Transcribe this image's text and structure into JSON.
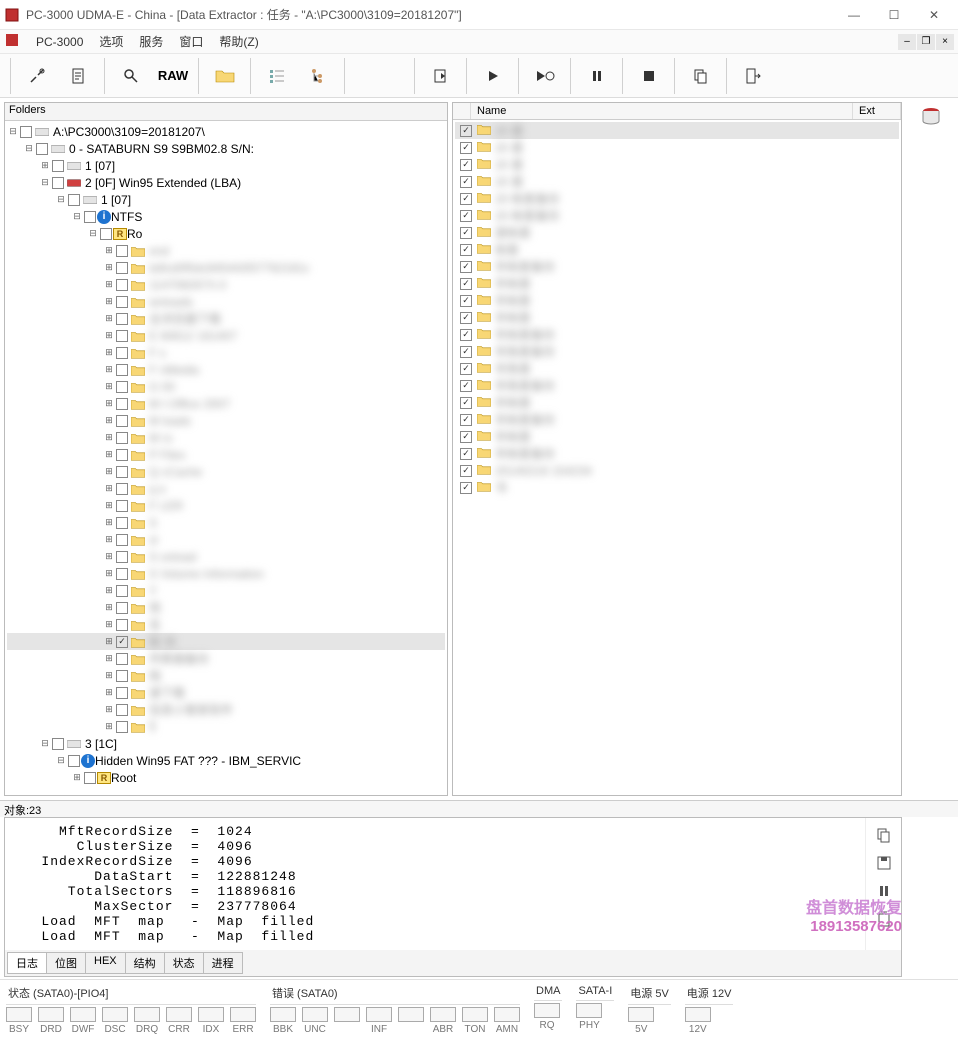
{
  "title": "PC-3000 UDMA-E - China - [Data Extractor : 任务 - \"A:\\PC3000\\3109=20181207\"]",
  "menu": {
    "app": "PC-3000",
    "items": [
      "选项",
      "服务",
      "窗口",
      "帮助(Z)"
    ]
  },
  "toolbar": {
    "raw": "RAW"
  },
  "left": {
    "header": "Folders",
    "tree": [
      {
        "d": 0,
        "t": "minus",
        "c": false,
        "icon": "disk",
        "label": "A:\\PC3000\\3109=20181207\\"
      },
      {
        "d": 1,
        "t": "minus",
        "c": false,
        "icon": "disk",
        "label": "0 - SATABURN   S9 S9BM02.8 S/N:"
      },
      {
        "d": 2,
        "t": "plus",
        "c": false,
        "icon": "disk",
        "label": "1 [07]"
      },
      {
        "d": 2,
        "t": "minus",
        "c": false,
        "icon": "disk-red",
        "label": "2 [0F] Win95 Extended  (LBA)"
      },
      {
        "d": 3,
        "t": "minus",
        "c": false,
        "icon": "disk",
        "label": "1 [07]"
      },
      {
        "d": 4,
        "t": "minus",
        "c": false,
        "icon": "info",
        "label": "NTFS"
      },
      {
        "d": 5,
        "t": "minus",
        "c": false,
        "icon": "root",
        "label": "Ro"
      },
      {
        "d": 6,
        "t": "plus",
        "c": false,
        "icon": "folder",
        "label": "         end",
        "blur": true
      },
      {
        "d": 6,
        "t": "plus",
        "c": false,
        "icon": "folder",
        "label": "  la9cd0f5dc845443f37762181c",
        "blur": true
      },
      {
        "d": 6,
        "t": "plus",
        "c": false,
        "icon": "folder",
        "label": "   114708267X.0",
        "blur": true
      },
      {
        "d": 6,
        "t": "plus",
        "c": false,
        "icon": "folder",
        "label": "  wnloads",
        "blur": true
      },
      {
        "d": 6,
        "t": "plus",
        "c": false,
        "icon": "folder",
        "label": "   全浏览器下载",
        "blur": true
      },
      {
        "d": 6,
        "t": "plus",
        "c": false,
        "icon": "folder",
        "label": "E   60612 161407",
        "blur": true
      },
      {
        "d": 6,
        "t": "plus",
        "c": false,
        "icon": "folder",
        "label": "F      s",
        "blur": true
      },
      {
        "d": 6,
        "t": "plus",
        "c": false,
        "icon": "folder",
        "label": "F    nMedia",
        "blur": true
      },
      {
        "d": 6,
        "t": "plus",
        "c": false,
        "icon": "folder",
        "label": "G    00",
        "blur": true
      },
      {
        "d": 6,
        "t": "plus",
        "c": false,
        "icon": "folder",
        "label": "M    t Office 2007",
        "blur": true
      },
      {
        "d": 6,
        "t": "plus",
        "c": false,
        "icon": "folder",
        "label": "M    loads",
        "blur": true
      },
      {
        "d": 6,
        "t": "plus",
        "c": false,
        "icon": "folder",
        "label": "M    rs",
        "blur": true
      },
      {
        "d": 6,
        "t": "plus",
        "c": false,
        "icon": "folder",
        "label": "P    Files",
        "blur": true
      },
      {
        "d": 6,
        "t": "plus",
        "c": false,
        "icon": "folder",
        "label": "Q    cCache",
        "blur": true
      },
      {
        "d": 6,
        "t": "plus",
        "c": false,
        "icon": "folder",
        "label": "q     e",
        "blur": true
      },
      {
        "d": 6,
        "t": "plus",
        "c": false,
        "icon": "folder",
        "label": "F    LER",
        "blur": true
      },
      {
        "d": 6,
        "t": "plus",
        "c": false,
        "icon": "folder",
        "label": "S",
        "blur": true
      },
      {
        "d": 6,
        "t": "plus",
        "c": false,
        "icon": "folder",
        "label": "sl",
        "blur": true
      },
      {
        "d": 6,
        "t": "plus",
        "c": false,
        "icon": "folder",
        "label": "S    onload",
        "blur": true
      },
      {
        "d": 6,
        "t": "plus",
        "c": false,
        "icon": "folder",
        "label": "S    Volume Information",
        "blur": true
      },
      {
        "d": 6,
        "t": "plus",
        "c": false,
        "icon": "folder",
        "label": "Y",
        "blur": true
      },
      {
        "d": 6,
        "t": "plus",
        "c": false,
        "icon": "folder",
        "label": "     悦",
        "blur": true
      },
      {
        "d": 6,
        "t": "plus",
        "c": false,
        "icon": "folder",
        "label": "名",
        "blur": true
      },
      {
        "d": 6,
        "t": "plus",
        "c": true,
        "icon": "folder",
        "label": "帐    份",
        "blur": true,
        "sel": true
      },
      {
        "d": 6,
        "t": "plus",
        "c": false,
        "icon": "folder",
        "label": "    件数据备份",
        "blur": true
      },
      {
        "d": 6,
        "t": "plus",
        "c": false,
        "icon": "folder",
        "label": "     档",
        "blur": true
      },
      {
        "d": 6,
        "t": "plus",
        "c": false,
        "icon": "folder",
        "label": "    速下载",
        "blur": true
      },
      {
        "d": 6,
        "t": "plus",
        "c": false,
        "icon": "folder",
        "label": "    信息小管家软件",
        "blur": true
      },
      {
        "d": 6,
        "t": "plus",
        "c": false,
        "icon": "folder",
        "label": "钅",
        "blur": true
      },
      {
        "d": 2,
        "t": "minus",
        "c": false,
        "icon": "disk",
        "label": "3 [1C]"
      },
      {
        "d": 3,
        "t": "minus",
        "c": false,
        "icon": "info",
        "label": "Hidden Win95 FAT ??? - IBM_SERVIC"
      },
      {
        "d": 4,
        "t": "plus",
        "c": false,
        "icon": "root",
        "label": "Root"
      }
    ]
  },
  "right": {
    "cols": {
      "name": "Name",
      "ext": "Ext"
    },
    "rows": [
      {
        "c": true,
        "label": "20     套",
        "sel": true
      },
      {
        "c": true,
        "label": "20     套"
      },
      {
        "c": true,
        "label": "20     套"
      },
      {
        "c": true,
        "label": "20     套"
      },
      {
        "c": true,
        "label": "20    帐套备份"
      },
      {
        "c": true,
        "label": "20    帐套备份"
      },
      {
        "c": true,
        "label": "      度帐套"
      },
      {
        "c": true,
        "label": "      帐套"
      },
      {
        "c": true,
        "label": "     年帐套备份"
      },
      {
        "c": true,
        "label": "     年帐套"
      },
      {
        "c": true,
        "label": "     年帐套"
      },
      {
        "c": true,
        "label": "     年帐套"
      },
      {
        "c": true,
        "label": "     年帐套备份"
      },
      {
        "c": true,
        "label": "     年账套备份"
      },
      {
        "c": true,
        "label": "     年账套"
      },
      {
        "c": true,
        "label": "     年账套备份"
      },
      {
        "c": true,
        "label": "     年帐套"
      },
      {
        "c": true,
        "label": "     年帐套备份"
      },
      {
        "c": true,
        "label": "     年帐套"
      },
      {
        "c": true,
        "label": "     年帐套备份"
      },
      {
        "c": true,
        "label": "   20140216 154234"
      },
      {
        "c": true,
        "label": "      书"
      }
    ]
  },
  "status": "对象:23",
  "log": {
    "lines": [
      "     MftRecordSize  =  1024",
      "       ClusterSize  =  4096",
      "   IndexRecordSize  =  4096",
      "         DataStart  =  122881248",
      "      TotalSectors  =  118896816",
      "         MaxSector  =  237778064",
      "   Load  MFT  map   -  Map  filled",
      "   Load  MFT  map   -  Map  filled"
    ],
    "tabs": [
      "日志",
      "位图",
      "HEX",
      "结构",
      "状态",
      "进程"
    ],
    "activeTab": 0
  },
  "watermark": {
    "line1": "盘首数据恢复",
    "line2": "18913587620"
  },
  "lights": {
    "groups": [
      {
        "title": "状态 (SATA0)-[PIO4]",
        "items": [
          "BSY",
          "DRD",
          "DWF",
          "DSC",
          "DRQ",
          "CRR",
          "IDX",
          "ERR"
        ]
      },
      {
        "title": "错误 (SATA0)",
        "items": [
          "BBK",
          "UNC",
          "",
          "INF",
          "",
          "ABR",
          "TON",
          "AMN"
        ]
      },
      {
        "title": "DMA",
        "items": [
          "RQ"
        ]
      },
      {
        "title": "SATA-I",
        "items": [
          "PHY"
        ]
      },
      {
        "title": "电源 5V",
        "items": [
          "5V"
        ]
      },
      {
        "title": "电源 12V",
        "items": [
          "12V"
        ]
      }
    ]
  }
}
